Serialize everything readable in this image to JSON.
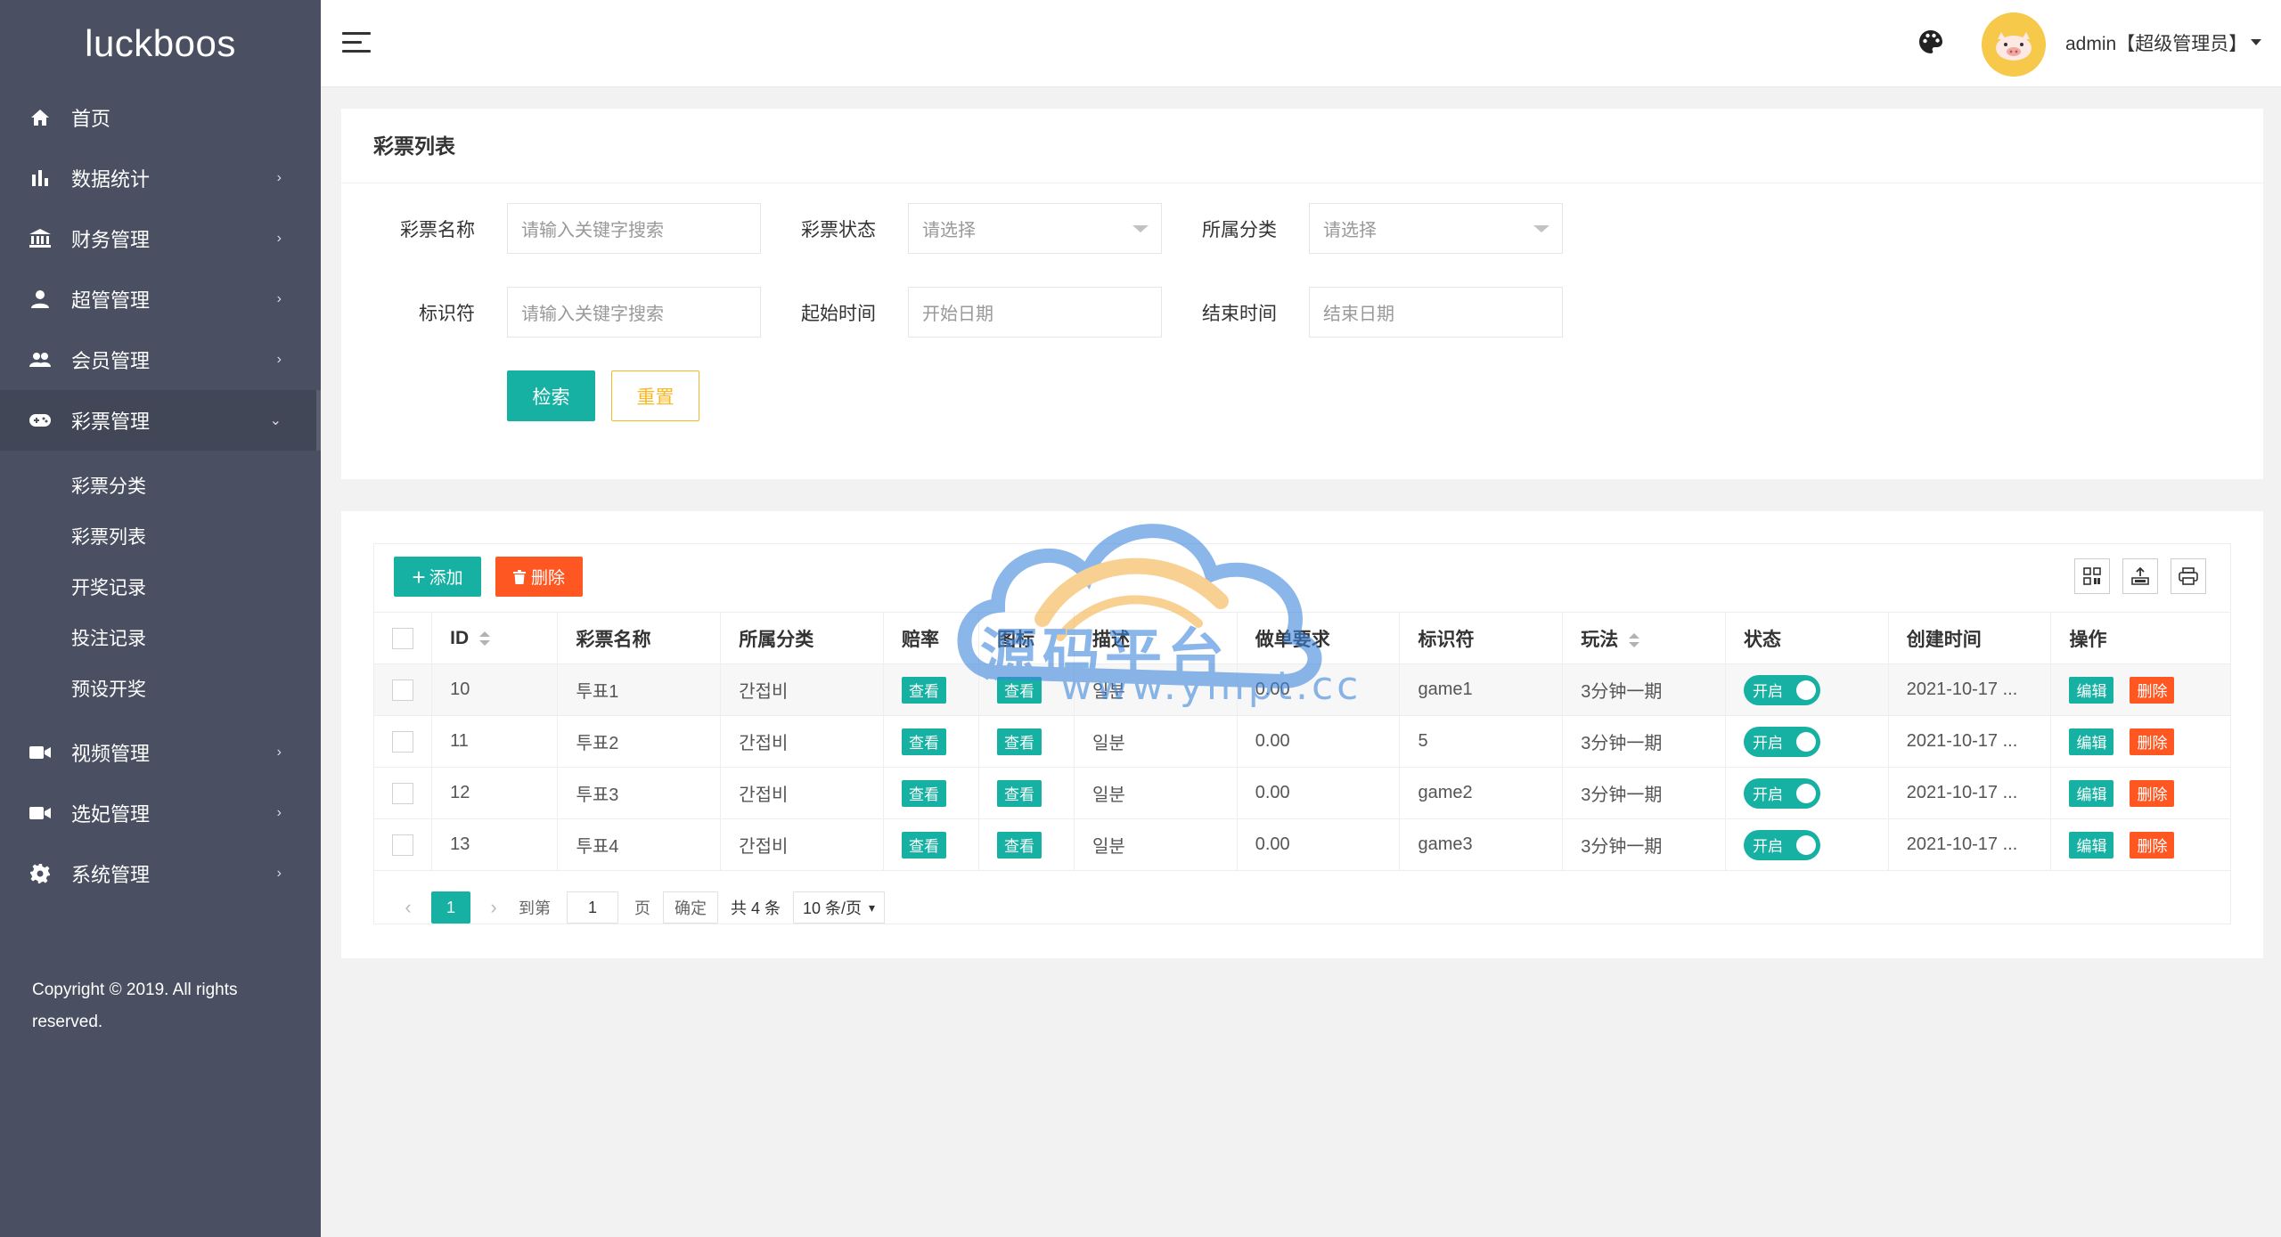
{
  "brand": "luckboos",
  "sidebar": {
    "items": [
      {
        "label": "首页",
        "icon": "home-icon"
      },
      {
        "label": "数据统计",
        "icon": "bar-chart-icon"
      },
      {
        "label": "财务管理",
        "icon": "bank-icon"
      },
      {
        "label": "超管管理",
        "icon": "user-icon"
      },
      {
        "label": "会员管理",
        "icon": "users-icon"
      },
      {
        "label": "彩票管理",
        "icon": "gamepad-icon"
      },
      {
        "label": "视频管理",
        "icon": "video-icon"
      },
      {
        "label": "选妃管理",
        "icon": "video-icon"
      },
      {
        "label": "系统管理",
        "icon": "gear-icon"
      }
    ],
    "sub_items": [
      "彩票分类",
      "彩票列表",
      "开奖记录",
      "投注记录",
      "预设开奖"
    ],
    "copyright": "Copyright © 2019. All rights reserved."
  },
  "header": {
    "user": "admin【超级管理员】"
  },
  "search": {
    "title": "彩票列表",
    "name_label": "彩票名称",
    "name_placeholder": "请输入关键字搜索",
    "status_label": "彩票状态",
    "status_value": "请选择",
    "category_label": "所属分类",
    "category_value": "请选择",
    "key_label": "标识符",
    "key_placeholder": "请输入关键字搜索",
    "start_label": "起始时间",
    "start_placeholder": "开始日期",
    "end_label": "结束时间",
    "end_placeholder": "结束日期",
    "search_btn": "检索",
    "reset_btn": "重置"
  },
  "toolbar": {
    "add_label": "添加",
    "delete_label": "删除"
  },
  "table": {
    "columns": [
      "ID",
      "彩票名称",
      "所属分类",
      "赔率",
      "图标",
      "描述",
      "做单要求",
      "标识符",
      "玩法",
      "状态",
      "创建时间",
      "操作"
    ],
    "view_label": "查看",
    "toggle_label": "开启",
    "edit_label": "编辑",
    "delete_label": "删除",
    "rows": [
      {
        "id": "10",
        "name": "투표1",
        "category": "간접비",
        "desc": "일분",
        "req": "0.00",
        "key": "game1",
        "play": "3分钟一期",
        "created": "2021-10-17 ..."
      },
      {
        "id": "11",
        "name": "투표2",
        "category": "간접비",
        "desc": "일분",
        "req": "0.00",
        "key": "5",
        "play": "3分钟一期",
        "created": "2021-10-17 ..."
      },
      {
        "id": "12",
        "name": "투표3",
        "category": "간접비",
        "desc": "일분",
        "req": "0.00",
        "key": "game2",
        "play": "3分钟一期",
        "created": "2021-10-17 ..."
      },
      {
        "id": "13",
        "name": "투표4",
        "category": "간접비",
        "desc": "일분",
        "req": "0.00",
        "key": "game3",
        "play": "3分钟一期",
        "created": "2021-10-17 ..."
      }
    ]
  },
  "pager": {
    "current": "1",
    "goto_label": "到第",
    "goto_value": "1",
    "page_unit": "页",
    "ok": "确定",
    "total": "共 4 条",
    "size": "10 条/页"
  },
  "watermark": {
    "text": "源码平台",
    "url": "www.ympt.cc"
  },
  "colors": {
    "sidebar": "#4a5061",
    "primary": "#16b1a2",
    "danger": "#ff5722",
    "warning": "#f7b824"
  }
}
